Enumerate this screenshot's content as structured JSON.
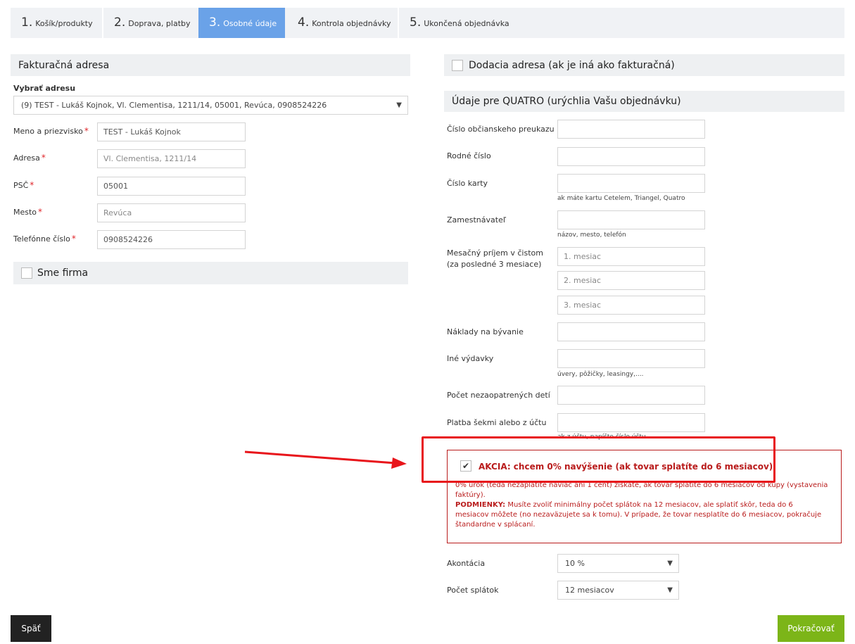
{
  "steps": [
    {
      "num": "1.",
      "label": "Košík/produkty"
    },
    {
      "num": "2.",
      "label": "Doprava, platby"
    },
    {
      "num": "3.",
      "label": "Osobné údaje"
    },
    {
      "num": "4.",
      "label": "Kontrola objednávky"
    },
    {
      "num": "5.",
      "label": "Ukončená objednávka"
    }
  ],
  "billing": {
    "title": "Fakturačná adresa",
    "select_label": "Vybrať adresu",
    "select_value": "(9) TEST - Lukáš Kojnok, Vl. Clementisa, 1211/14, 05001, Revúca, 0908524226",
    "fields": [
      {
        "label": "Meno a priezvisko",
        "value": "TEST - Lukáš Kojnok"
      },
      {
        "label": "Adresa",
        "value": "Vl. Clementisa, 1211/14"
      },
      {
        "label": "PSČ",
        "value": "05001"
      },
      {
        "label": "Mesto",
        "value": "Revúca"
      },
      {
        "label": "Telefónne číslo",
        "value": "0908524226"
      }
    ],
    "required_mark": "*",
    "company_label": "Sme firma"
  },
  "delivery": {
    "label": "Dodacia adresa (ak je iná ako fakturačná)"
  },
  "quatro": {
    "title": "Údaje pre QUATRO (urýchlia Vašu objednávku)",
    "id_card": "Číslo občianskeho preukazu",
    "birth_number": "Rodné číslo",
    "card_number": "Číslo karty",
    "card_hint": "ak máte kartu Cetelem, Triangel, Quatro",
    "employer": "Zamestnávateľ",
    "employer_hint": "názov, mesto, telefón",
    "income_line1": "Mesačný príjem v čistom",
    "income_line2": "(za posledné 3 mesiace)",
    "income_placeholders": [
      "1. mesiac",
      "2. mesiac",
      "3. mesiac"
    ],
    "housing": "Náklady na bývanie",
    "other_expenses": "Iné výdavky",
    "other_hint": "úvery, pôžičky, leasingy,....",
    "children": "Počet nezaopatrených detí",
    "payment": "Platba šekmi alebo z účtu",
    "payment_hint": "ak z účtu, napíšte číslo účtu"
  },
  "akcia": {
    "title": "AKCIA: chcem 0% navýšenie (ak tovar splatíte do 6 mesiacov)",
    "text1": "0% úrok (teda nezaplatíte navíac ani 1 cent) získate, ak tovar splatíte do 6 mesiacov od kúpy (vystavenia faktúry).",
    "cond_label": "PODMIENKY:",
    "text2": "Musíte zvoliť minimálny počet splátok na 12 mesiacov, ale splatiť skôr, teda do 6 mesiacov môžete (no nezaväzujete sa k tomu). V prípade, že tovar nesplatíte do 6 mesiacov, pokračuje štandardne v splácaní.",
    "checked": true,
    "check_glyph": "✔"
  },
  "akontacia": {
    "label": "Akontácia",
    "value": "10 %"
  },
  "installments": {
    "label": "Počet splátok",
    "value": "12 mesiacov"
  },
  "caret": "▼",
  "buttons": {
    "back": "Späť",
    "next": "Pokračovať"
  },
  "colors": {
    "active_step": "#6aa2e8",
    "next_button": "#7cb518",
    "akcia_red": "#b91c1c",
    "highlight": "#e8151b"
  }
}
